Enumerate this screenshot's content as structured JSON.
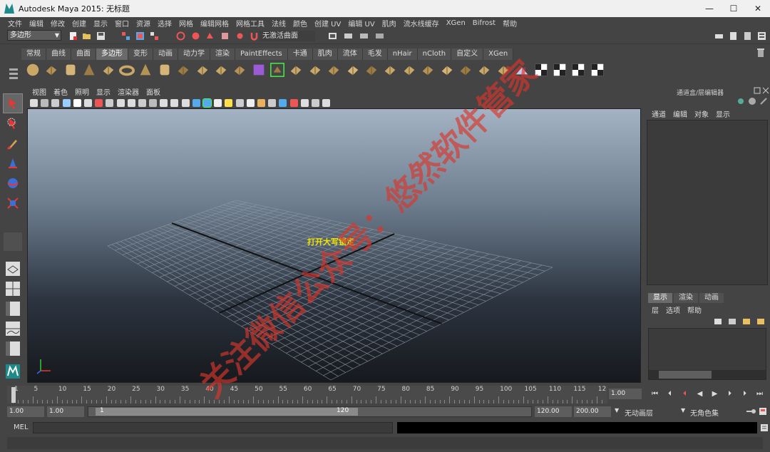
{
  "window": {
    "title": "Autodesk Maya 2015: 无标题",
    "minimize": "—",
    "maximize": "☐",
    "close": "✕"
  },
  "menu": [
    "文件",
    "编辑",
    "修改",
    "创建",
    "显示",
    "窗口",
    "资源",
    "选择",
    "网格",
    "编辑网格",
    "网格工具",
    "法线",
    "颜色",
    "创建 UV",
    "编辑 UV",
    "肌肉",
    "流水线缓存",
    "XGen",
    "Bifrost",
    "帮助"
  ],
  "status_line": {
    "mode": "多边形",
    "live_surface": "无激活曲面"
  },
  "shelf": {
    "tabs": [
      "常规",
      "曲线",
      "曲面",
      "多边形",
      "变形",
      "动画",
      "动力学",
      "渲染",
      "PaintEffects",
      "卡通",
      "肌肉",
      "流体",
      "毛发",
      "nHair",
      "nCloth",
      "自定义",
      "XGen"
    ],
    "active_tab": "多边形",
    "icons": [
      "poly-sphere",
      "poly-cube",
      "poly-cylinder",
      "poly-cone",
      "poly-plane",
      "poly-torus",
      "poly-pyramid",
      "poly-pipe",
      "poly-soccerball",
      "combine",
      "separate",
      "extract",
      "smooth",
      "average-vertices",
      "boolean-union",
      "mirror",
      "bevel",
      "extrude",
      "bridge",
      "append-polygon",
      "fill-hole",
      "split-polygon",
      "insert-edge-loop",
      "offset-edge-loop",
      "merge",
      "sculpt",
      "uv-editor",
      "uv-planar",
      "uv-cylindrical",
      "uv-spherical",
      "uv-auto"
    ]
  },
  "panel": {
    "menu": [
      "视图",
      "着色",
      "照明",
      "显示",
      "渲染器",
      "面板"
    ],
    "caps_lock_message": "打开大写锁定"
  },
  "channel_box": {
    "title": "通道盒/层编辑器",
    "menu": [
      "通道",
      "编辑",
      "对象",
      "显示"
    ]
  },
  "layer_editor": {
    "tabs": [
      "显示",
      "渲染",
      "动画"
    ],
    "active_tab": "显示",
    "menu": [
      "层",
      "选项",
      "帮助"
    ]
  },
  "time_slider": {
    "labels": [
      "1",
      "5",
      "10",
      "15",
      "20",
      "25",
      "30",
      "35",
      "40",
      "45",
      "50",
      "55",
      "60",
      "65",
      "70",
      "75",
      "80",
      "85",
      "90",
      "95",
      "100",
      "105",
      "110",
      "115",
      "12"
    ],
    "current_time": "1.00"
  },
  "range_slider": {
    "start_time": "1.00",
    "playback_start": "1.00",
    "range_start_label": "1",
    "range_end_label": "120",
    "playback_end": "120.00",
    "end_time": "200.00",
    "anim_layer": "无动画层",
    "character_set": "无角色集"
  },
  "command_line": {
    "label": "MEL"
  },
  "watermark": "关注微信公众号：悠然软件管家"
}
